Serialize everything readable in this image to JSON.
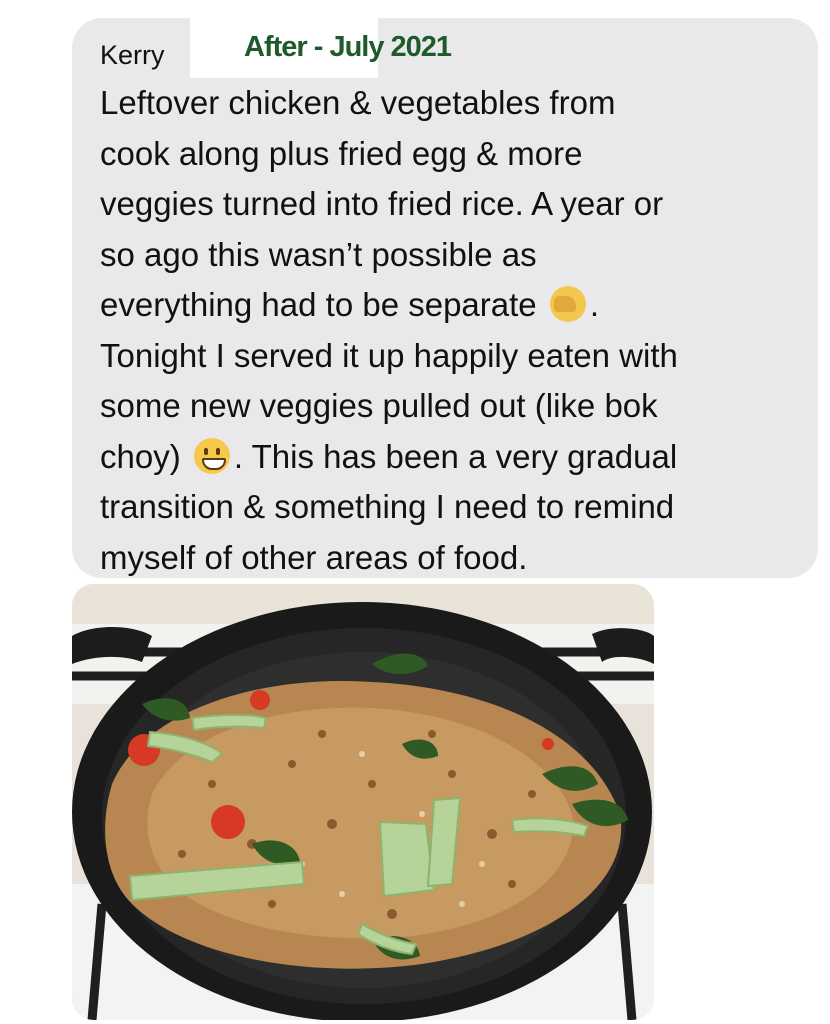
{
  "message": {
    "sender": "Kerry",
    "overlay_label": "After - July 2021",
    "lines": [
      "Leftover chicken & vegetables from",
      "cook along plus fried egg & more",
      "veggies turned into fried rice. A year or",
      "so ago this wasn’t possible as",
      "everything had to be separate",
      ".",
      "Tonight I served it up happily eaten with",
      "some new veggies pulled out (like bok",
      "choy)",
      ". This has been a very gradual",
      "transition & something I need to remind",
      "myself of other areas of food."
    ],
    "emojis": [
      "face-palm-emoji",
      "grinning-face-emoji"
    ]
  },
  "attachment": {
    "type": "photo",
    "subject": "fried rice with bok choy in cast iron pan"
  }
}
